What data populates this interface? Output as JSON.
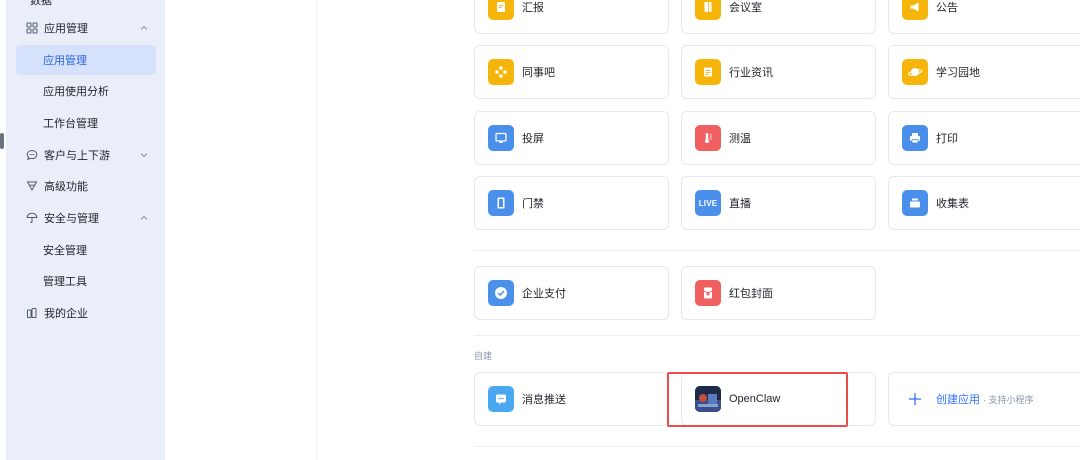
{
  "sidebar": {
    "top_partial": "数据",
    "items": [
      {
        "label": "应用管理",
        "icon": "grid-icon",
        "expand": "up"
      },
      {
        "label": "应用管理",
        "sub": true,
        "active": true
      },
      {
        "label": "应用使用分析",
        "sub": true
      },
      {
        "label": "工作台管理",
        "sub": true
      },
      {
        "label": "客户与上下游",
        "icon": "chat-icon",
        "expand": "down"
      },
      {
        "label": "高级功能",
        "icon": "funnel-icon"
      },
      {
        "label": "安全与管理",
        "icon": "umbrella-icon",
        "expand": "up"
      },
      {
        "label": "安全管理",
        "sub": true
      },
      {
        "label": "管理工具",
        "sub": true
      },
      {
        "label": "我的企业",
        "icon": "building-icon"
      }
    ]
  },
  "apps": {
    "row1": [
      {
        "label": "汇报",
        "icon": "report-icon",
        "color": "#f5b50a"
      },
      {
        "label": "会议室",
        "icon": "door-icon",
        "color": "#f5b50a"
      },
      {
        "label": "公告",
        "icon": "megaphone-icon",
        "color": "#f5b50a"
      }
    ],
    "row2": [
      {
        "label": "同事吧",
        "icon": "diamond-dots-icon",
        "color": "#f5b50a"
      },
      {
        "label": "行业资讯",
        "icon": "news-icon",
        "color": "#f5b50a"
      },
      {
        "label": "学习园地",
        "icon": "planet-icon",
        "color": "#f5b50a"
      }
    ],
    "row3": [
      {
        "label": "投屏",
        "icon": "screen-cast-icon",
        "color": "#4a90ea"
      },
      {
        "label": "测温",
        "icon": "thermometer-icon",
        "color": "#f06060"
      },
      {
        "label": "打印",
        "icon": "printer-icon",
        "color": "#4a90ea"
      }
    ],
    "row4": [
      {
        "label": "门禁",
        "icon": "access-door-icon",
        "color": "#4a90ea"
      },
      {
        "label": "直播",
        "icon": "live-icon",
        "icon_text": "LIVE",
        "color": "#4a90ea"
      },
      {
        "label": "收集表",
        "icon": "inbox-icon",
        "color": "#4a90ea"
      }
    ],
    "row5": [
      {
        "label": "企业支付",
        "icon": "pay-icon",
        "color": "#4a90ea"
      },
      {
        "label": "红包封面",
        "icon": "red-packet-icon",
        "color": "#f06060"
      }
    ]
  },
  "custom_section": {
    "label": "自建",
    "items": [
      {
        "label": "消息推送",
        "icon": "message-icon",
        "color": "#4aa8f0"
      },
      {
        "label": "OpenClaw",
        "icon": "openclaw-logo-icon",
        "color": "#2a3a6a"
      }
    ],
    "create": {
      "main": "创建应用",
      "sub": "· 支持小程序"
    }
  }
}
